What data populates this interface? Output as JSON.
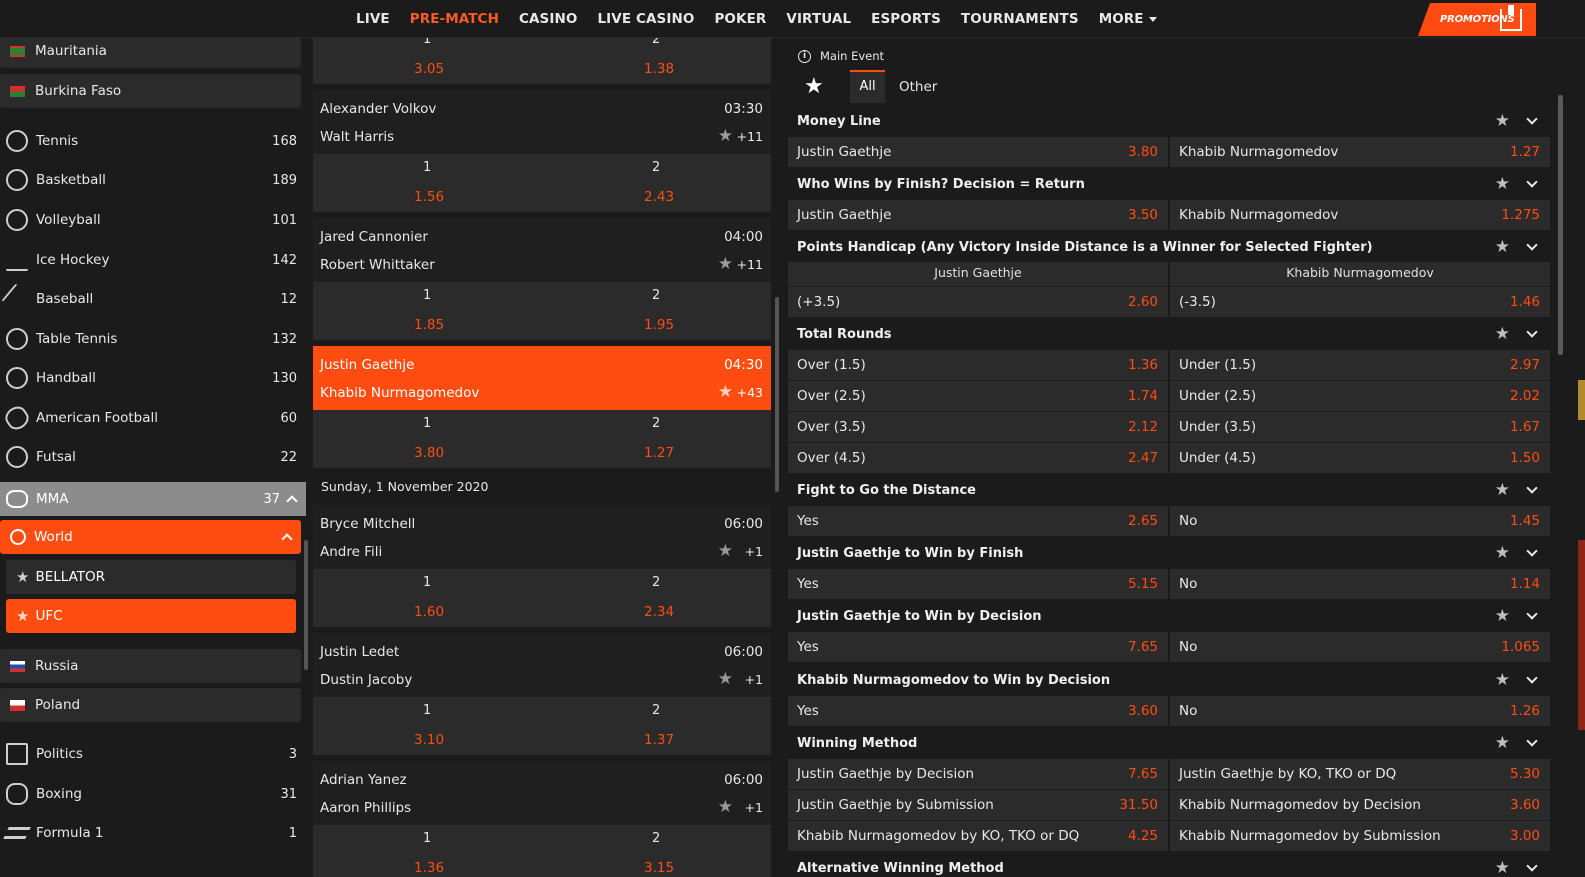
{
  "nav": {
    "items": [
      {
        "label": "LIVE",
        "active": false
      },
      {
        "label": "PRE-MATCH",
        "active": true
      },
      {
        "label": "CASINO",
        "active": false
      },
      {
        "label": "LIVE CASINO",
        "active": false
      },
      {
        "label": "POKER",
        "active": false
      },
      {
        "label": "VIRTUAL",
        "active": false
      },
      {
        "label": "ESPORTS",
        "active": false
      },
      {
        "label": "TOURNAMENTS",
        "active": false
      },
      {
        "label": "MORE",
        "active": false
      }
    ],
    "promo": "PROMOTIONS"
  },
  "colors": {
    "accent": "#ff4d12",
    "bg": "#1b1b1b",
    "panel": "#2b2b2b"
  },
  "sidebar": {
    "countries_top": [
      {
        "label": "Mauritania"
      },
      {
        "label": "Burkina Faso"
      }
    ],
    "sports": [
      {
        "label": "Tennis",
        "count": "168",
        "icon": "tennis-icon"
      },
      {
        "label": "Basketball",
        "count": "189",
        "icon": "basketball-icon"
      },
      {
        "label": "Volleyball",
        "count": "101",
        "icon": "volleyball-icon"
      },
      {
        "label": "Ice Hockey",
        "count": "142",
        "icon": "ice-hockey-icon"
      },
      {
        "label": "Baseball",
        "count": "12",
        "icon": "baseball-icon"
      },
      {
        "label": "Table Tennis",
        "count": "132",
        "icon": "table-tennis-icon"
      },
      {
        "label": "Handball",
        "count": "130",
        "icon": "handball-icon"
      },
      {
        "label": "American Football",
        "count": "60",
        "icon": "american-football-icon"
      },
      {
        "label": "Futsal",
        "count": "22",
        "icon": "futsal-icon"
      }
    ],
    "mma": {
      "label": "MMA",
      "count": "37"
    },
    "world": {
      "label": "World"
    },
    "leagues": [
      {
        "label": "BELLATOR"
      },
      {
        "label": "UFC"
      }
    ],
    "countries_bottom": [
      {
        "label": "Russia"
      },
      {
        "label": "Poland"
      }
    ],
    "sports_bottom": [
      {
        "label": "Politics",
        "count": "3",
        "icon": "politics-icon"
      },
      {
        "label": "Boxing",
        "count": "31",
        "icon": "boxing-icon"
      },
      {
        "label": "Formula 1",
        "count": "1",
        "icon": "formula1-icon"
      }
    ]
  },
  "events": {
    "top_odds": {
      "l1": "1",
      "l2": "2",
      "o1": "3.05",
      "o2": "1.38"
    },
    "list": [
      {
        "team1": "Alexander Volkov",
        "team2": "Walt Harris",
        "time": "03:30",
        "more": "+11",
        "l1": "1",
        "l2": "2",
        "o1": "1.56",
        "o2": "2.43"
      },
      {
        "team1": "Jared Cannonier",
        "team2": "Robert Whittaker",
        "time": "04:00",
        "more": "+11",
        "l1": "1",
        "l2": "2",
        "o1": "1.85",
        "o2": "1.95"
      },
      {
        "team1": "Justin Gaethje",
        "team2": "Khabib Nurmagomedov",
        "time": "04:30",
        "more": "+43",
        "l1": "1",
        "l2": "2",
        "o1": "3.80",
        "o2": "1.27"
      },
      {
        "team1": "Bryce Mitchell",
        "team2": "Andre Fili",
        "time": "06:00",
        "more": "+1",
        "l1": "1",
        "l2": "2",
        "o1": "1.60",
        "o2": "2.34"
      },
      {
        "team1": "Justin Ledet",
        "team2": "Dustin Jacoby",
        "time": "06:00",
        "more": "+1",
        "l1": "1",
        "l2": "2",
        "o1": "3.10",
        "o2": "1.37"
      },
      {
        "team1": "Adrian Yanez",
        "team2": "Aaron Phillips",
        "time": "06:00",
        "more": "+1",
        "l1": "1",
        "l2": "2",
        "o1": "1.36",
        "o2": "3.15"
      }
    ],
    "date_label": "Sunday, 1 November 2020"
  },
  "markets": {
    "main_event": "Main Event",
    "tab_all": "All",
    "tab_other": "Other",
    "money_line": {
      "title": "Money Line",
      "cells": [
        [
          "Justin Gaethje",
          "3.80",
          "Khabib Nurmagomedov",
          "1.27"
        ]
      ]
    },
    "wins_by_finish": {
      "title": "Who Wins by Finish? Decision = Return",
      "cells": [
        [
          "Justin Gaethje",
          "3.50",
          "Khabib Nurmagomedov",
          "1.275"
        ]
      ]
    },
    "points_handicap": {
      "title": "Points Handicap (Any Victory Inside Distance is a Winner for Selected Fighter)",
      "col1": "Justin Gaethje",
      "col2": "Khabib Nurmagomedov",
      "cells": [
        [
          "(+3.5)",
          "2.60",
          "(-3.5)",
          "1.46"
        ]
      ]
    },
    "total_rounds": {
      "title": "Total Rounds",
      "cells": [
        [
          "Over (1.5)",
          "1.36",
          "Under (1.5)",
          "2.97"
        ],
        [
          "Over (2.5)",
          "1.74",
          "Under (2.5)",
          "2.02"
        ],
        [
          "Over (3.5)",
          "2.12",
          "Under (3.5)",
          "1.67"
        ],
        [
          "Over (4.5)",
          "2.47",
          "Under (4.5)",
          "1.50"
        ]
      ]
    },
    "distance": {
      "title": "Fight to Go the Distance",
      "cells": [
        [
          "Yes",
          "2.65",
          "No",
          "1.45"
        ]
      ]
    },
    "gaethje_finish": {
      "title": "Justin Gaethje to Win by Finish",
      "cells": [
        [
          "Yes",
          "5.15",
          "No",
          "1.14"
        ]
      ]
    },
    "gaethje_decision": {
      "title": "Justin Gaethje to Win by Decision",
      "cells": [
        [
          "Yes",
          "7.65",
          "No",
          "1.065"
        ]
      ]
    },
    "khabib_decision": {
      "title": "Khabib Nurmagomedov to Win by Decision",
      "cells": [
        [
          "Yes",
          "3.60",
          "No",
          "1.26"
        ]
      ]
    },
    "winning_method": {
      "title": "Winning Method",
      "cells": [
        [
          "Justin Gaethje by Decision",
          "7.65",
          "Justin Gaethje by KO, TKO or DQ",
          "5.30"
        ],
        [
          "Justin Gaethje by Submission",
          "31.50",
          "Khabib Nurmagomedov by Decision",
          "3.60"
        ],
        [
          "Khabib Nurmagomedov by KO, TKO or DQ",
          "4.25",
          "Khabib Nurmagomedov by Submission",
          "3.00"
        ]
      ]
    },
    "alt_method": {
      "title": "Alternative Winning Method"
    }
  }
}
